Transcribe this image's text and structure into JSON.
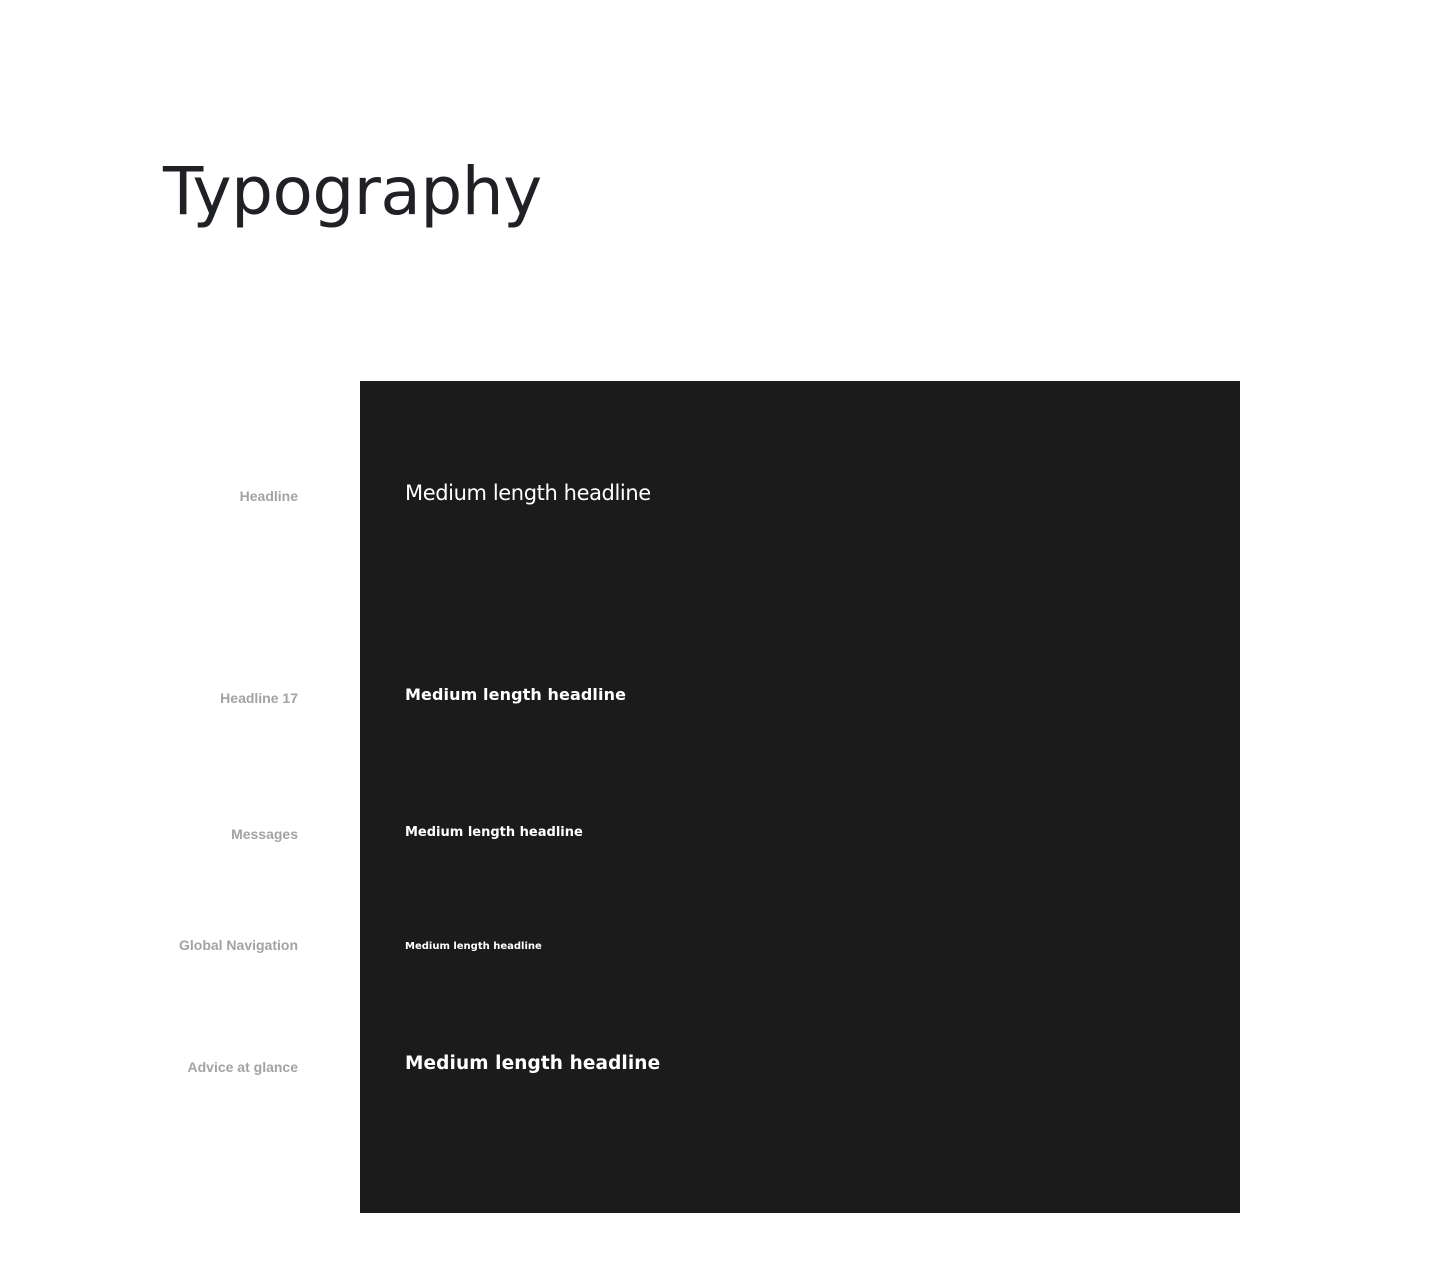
{
  "page": {
    "title": "Typography"
  },
  "styles": [
    {
      "label": "Headline",
      "sample": "Medium length headline"
    },
    {
      "label": "Headline 17",
      "sample": "Medium length headline"
    },
    {
      "label": "Messages",
      "sample": "Medium length headline"
    },
    {
      "label": "Global Navigation",
      "sample": "Medium length headline"
    },
    {
      "label": "Advice at glance",
      "sample": "Medium length headline"
    }
  ],
  "colors": {
    "background": "#ffffff",
    "title": "#202124",
    "label": "#a3a3a3",
    "panel": "#1b1b1b",
    "sample_text": "#ffffff"
  }
}
